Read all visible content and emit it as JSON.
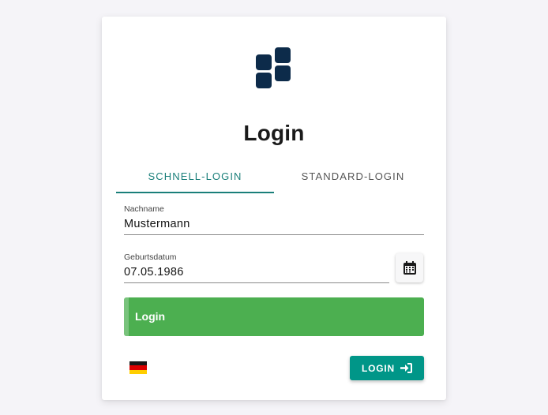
{
  "app": {
    "title": "Login"
  },
  "tabs": [
    {
      "label": "SCHNELL-LOGIN",
      "active": true
    },
    {
      "label": "STANDARD-LOGIN",
      "active": false
    }
  ],
  "form": {
    "lastname": {
      "label": "Nachname",
      "value": "Mustermann"
    },
    "birthdate": {
      "label": "Geburtsdatum",
      "value": "07.05.1986"
    },
    "calendar_icon": "calendar-icon",
    "green_button_label": "Login"
  },
  "footer": {
    "language_flag": "german-flag-icon",
    "login_button_label": "LOGIN",
    "login_icon": "sign-in-icon"
  },
  "colors": {
    "accent": "#1a7f7a",
    "logo": "#0d2b4a",
    "green_button": "#4caf50",
    "teal_button": "#009688",
    "background": "#f5f4f8"
  }
}
